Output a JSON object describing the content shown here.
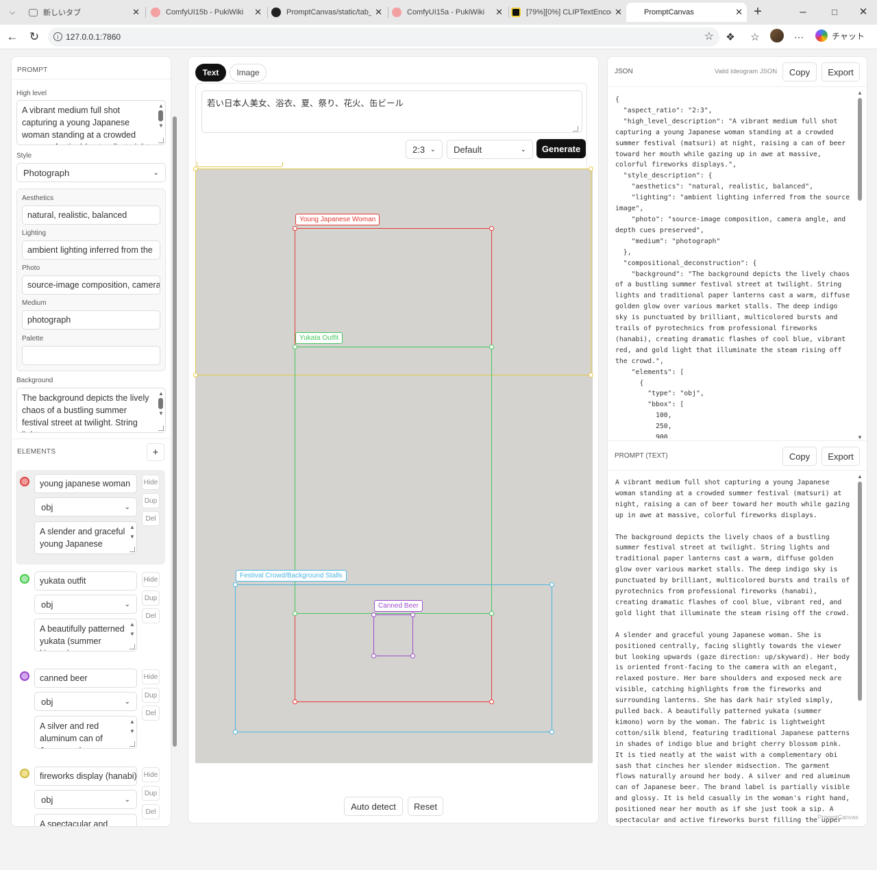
{
  "browser": {
    "tabs": [
      {
        "title": "新しいタブ"
      },
      {
        "title": "ComfyUI15b - PukiWiki"
      },
      {
        "title": "PromptCanvas/static/tab_"
      },
      {
        "title": "ComfyUI15a - PukiWiki"
      },
      {
        "title": "[79%][0%] CLIPTextEncode"
      },
      {
        "title": "PromptCanvas"
      }
    ],
    "url": "127.0.0.1:7860",
    "chat_label": "チャット"
  },
  "left": {
    "prompt_heading": "PROMPT",
    "high_level_label": "High level",
    "high_level_text": "A vibrant medium full shot capturing a young Japanese woman standing at a crowded summer festival (matsuri) at night",
    "style_label": "Style",
    "style_value": "Photograph",
    "aesthetics_label": "Aesthetics",
    "aesthetics_value": "natural, realistic, balanced",
    "lighting_label": "Lighting",
    "lighting_value": "ambient lighting inferred from the",
    "photo_label": "Photo",
    "photo_value": "source-image composition, camera",
    "medium_label": "Medium",
    "medium_value": "photograph",
    "palette_label": "Palette",
    "palette_value": "",
    "background_label": "Background",
    "background_text": "The background depicts the lively chaos of a bustling summer festival street at twilight. String lights",
    "elements_heading": "ELEMENTS",
    "add_label": "+",
    "elements": [
      {
        "name": "young japanese woman",
        "type": "obj",
        "desc": "A slender and graceful young Japanese woman.",
        "color": "#e05050"
      },
      {
        "name": "yukata outfit",
        "type": "obj",
        "desc": "A beautifully patterned yukata (summer kimono)",
        "color": "#50c878"
      },
      {
        "name": "canned beer",
        "type": "obj",
        "desc": "A silver and red aluminum can of Japanese beer.",
        "color": "#a050d0"
      },
      {
        "name": "fireworks display (hanabi)",
        "type": "obj",
        "desc": "A spectacular and active fireworks burst",
        "color": "#d8c040"
      }
    ],
    "hide_label": "Hide",
    "dup_label": "Dup",
    "del_label": "Del"
  },
  "middle": {
    "tab_text": "Text",
    "tab_image": "Image",
    "prompt_input": "若い日本人美女、浴衣、夏、祭り、花火、缶ビール",
    "aspect_value": "2:3",
    "preset_value": "Default",
    "generate_label": "Generate",
    "boxes": [
      {
        "label": "Young Japanese Woman",
        "color": "#e53935"
      },
      {
        "label": "Yukata Outfit",
        "color": "#43c65a"
      },
      {
        "label": "Festival Crowd/Background Stalls",
        "color": "#4db6e2"
      },
      {
        "label": "Canned Beer",
        "color": "#9c4dcc"
      }
    ],
    "fireworks_color": "#e6c84a",
    "auto_detect_label": "Auto detect",
    "reset_label": "Reset"
  },
  "right": {
    "json_heading": "JSON",
    "valid_label": "Valid Ideogram JSON",
    "copy_label": "Copy",
    "export_label": "Export",
    "json_text": "{\n  \"aspect_ratio\": \"2:3\",\n  \"high_level_description\": \"A vibrant medium full shot capturing a young Japanese woman standing at a crowded summer festival (matsuri) at night, raising a can of beer toward her mouth while gazing up in awe at massive, colorful fireworks displays.\",\n  \"style_description\": {\n    \"aesthetics\": \"natural, realistic, balanced\",\n    \"lighting\": \"ambient lighting inferred from the source image\",\n    \"photo\": \"source-image composition, camera angle, and depth cues preserved\",\n    \"medium\": \"photograph\"\n  },\n  \"compositional_deconstruction\": {\n    \"background\": \"The background depicts the lively chaos of a bustling summer festival street at twilight. String lights and traditional paper lanterns cast a warm, diffuse golden glow over various market stalls. The deep indigo sky is punctuated by brilliant, multicolored bursts and trails of pyrotechnics from professional fireworks (hanabi), creating dramatic flashes of cool blue, vibrant red, and gold light that illuminate the steam rising off the crowd.\",\n    \"elements\": [\n      {\n        \"type\": \"obj\",\n        \"bbox\": [\n          100,\n          250,\n          900,",
    "prompt_heading": "PROMPT (TEXT)",
    "prompt_text": "A vibrant medium full shot capturing a young Japanese woman standing at a crowded summer festival (matsuri) at night, raising a can of beer toward her mouth while gazing up in awe at massive, colorful fireworks displays.\n\nThe background depicts the lively chaos of a bustling summer festival street at twilight. String lights and traditional paper lanterns cast a warm, diffuse golden glow over various market stalls. The deep indigo sky is punctuated by brilliant, multicolored bursts and trails of pyrotechnics from professional fireworks (hanabi), creating dramatic flashes of cool blue, vibrant red, and gold light that illuminate the steam rising off the crowd.\n\nA slender and graceful young Japanese woman. She is positioned centrally, facing slightly towards the viewer but looking upwards (gaze direction: up/skyward). Her body is oriented front-facing to the camera with an elegant, relaxed posture. Her bare shoulders and exposed neck are visible, catching highlights from the fireworks and surrounding lanterns. She has dark hair styled simply, pulled back. A beautifully patterned yukata (summer kimono) worn by the woman. The fabric is lightweight cotton/silk blend, featuring traditional Japanese patterns in shades of indigo blue and bright cherry blossom pink. It is tied neatly at the waist with a complementary obi sash that cinches her slender midsection. The garment flows naturally around her body. A silver and red aluminum can of Japanese beer. The brand label is partially visible and glossy. It is held casually in the woman's right hand, positioned near her mouth as if she just took a sip. A spectacular and active fireworks burst filling the upper",
    "watermark": "PromptCanvas"
  }
}
